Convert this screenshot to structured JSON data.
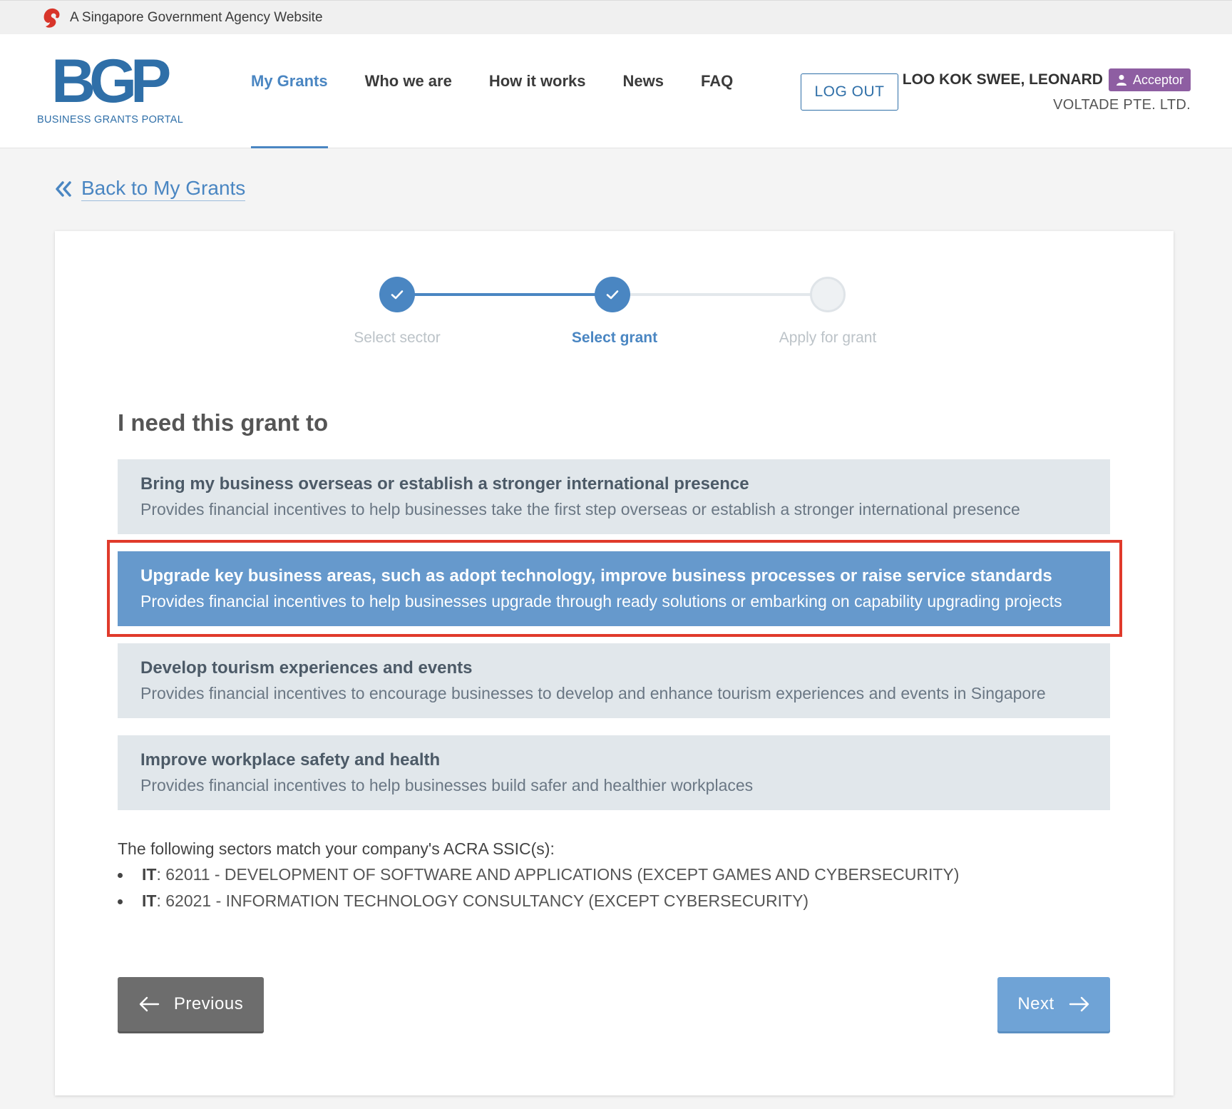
{
  "masthead": {
    "text": "A Singapore Government Agency Website"
  },
  "logo": {
    "mark": "BGP",
    "subtitle": "BUSINESS GRANTS PORTAL"
  },
  "nav": {
    "items": [
      {
        "label": "My Grants",
        "active": true
      },
      {
        "label": "Who we are",
        "active": false
      },
      {
        "label": "How it works",
        "active": false
      },
      {
        "label": "News",
        "active": false
      },
      {
        "label": "FAQ",
        "active": false
      }
    ]
  },
  "header": {
    "logout_label": "LOG OUT"
  },
  "user": {
    "name": "LOO KOK SWEE, LEONARD",
    "role": "Acceptor",
    "company": "VOLTADE PTE. LTD."
  },
  "back": {
    "label": "Back to My Grants"
  },
  "stepper": {
    "steps": [
      {
        "label": "Select sector",
        "state": "done"
      },
      {
        "label": "Select grant",
        "state": "current"
      },
      {
        "label": "Apply for grant",
        "state": "todo"
      }
    ]
  },
  "main": {
    "heading": "I need this grant to",
    "options": [
      {
        "title": "Bring my business overseas or establish a stronger international presence",
        "description": "Provides financial incentives to help businesses take the first step overseas or establish a stronger international presence",
        "selected": false
      },
      {
        "title": "Upgrade key business areas, such as adopt technology, improve business processes or raise service standards",
        "description": "Provides financial incentives to help businesses upgrade through ready solutions or embarking on capability upgrading projects",
        "selected": true
      },
      {
        "title": "Develop tourism experiences and events",
        "description": "Provides financial incentives to encourage businesses to develop and enhance tourism experiences and events in Singapore",
        "selected": false
      },
      {
        "title": "Improve workplace safety and health",
        "description": "Provides financial incentives to help businesses build safer and healthier workplaces",
        "selected": false
      }
    ],
    "sectors_intro": "The following sectors match your company's ACRA SSIC(s):",
    "sectors": [
      {
        "code": "IT",
        "text": ": 62011 - DEVELOPMENT OF SOFTWARE AND APPLICATIONS (EXCEPT GAMES AND CYBERSECURITY)"
      },
      {
        "code": "IT",
        "text": ": 62021 - INFORMATION TECHNOLOGY CONSULTANCY (EXCEPT CYBERSECURITY)"
      }
    ]
  },
  "footer_buttons": {
    "previous_label": "Previous",
    "next_label": "Next"
  },
  "colors": {
    "brand": "#2f6fa8",
    "accent": "#4a86c2",
    "selected_option": "#6699cc",
    "role_badge": "#8e5ea2",
    "highlight": "#e03a2b"
  },
  "icons": {
    "masthead": "lion-head-icon",
    "role": "person-icon",
    "back": "double-chevron-left-icon",
    "step_done": "check-icon",
    "previous": "arrow-left-icon",
    "next": "arrow-right-icon"
  }
}
